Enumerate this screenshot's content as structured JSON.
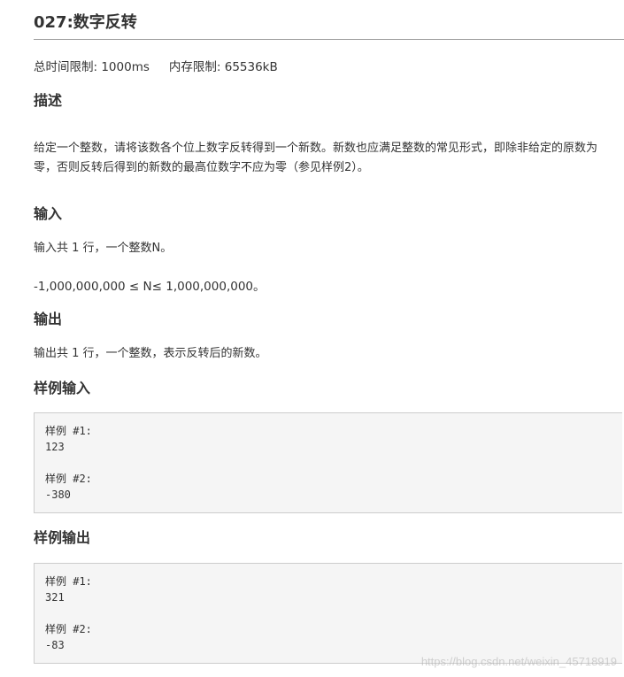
{
  "problem": {
    "title": "027:数字反转",
    "time_limit": "总时间限制: 1000ms",
    "memory_limit": "内存限制: 65536kB"
  },
  "description": {
    "heading": "描述",
    "text": "给定一个整数，请将该数各个位上数字反转得到一个新数。新数也应满足整数的常见形式，即除非给定的原数为零，否则反转后得到的新数的最高位数字不应为零（参见样例2）。"
  },
  "input": {
    "heading": "输入",
    "line1": "输入共 1 行，一个整数N。",
    "line2": "-1,000,000,000 ≤ N≤ 1,000,000,000。"
  },
  "output": {
    "heading": "输出",
    "line1": "输出共 1 行，一个整数，表示反转后的新数。"
  },
  "sample_input": {
    "heading": "样例输入",
    "items": [
      {
        "label": "样例 #1:",
        "value": "123"
      },
      {
        "label": "样例 #2:",
        "value": "-380"
      }
    ]
  },
  "sample_output": {
    "heading": "样例输出",
    "items": [
      {
        "label": "样例 #1:",
        "value": "321"
      },
      {
        "label": "样例 #2:",
        "value": "-83"
      }
    ]
  },
  "watermark": "https://blog.csdn.net/weixin_45718919"
}
